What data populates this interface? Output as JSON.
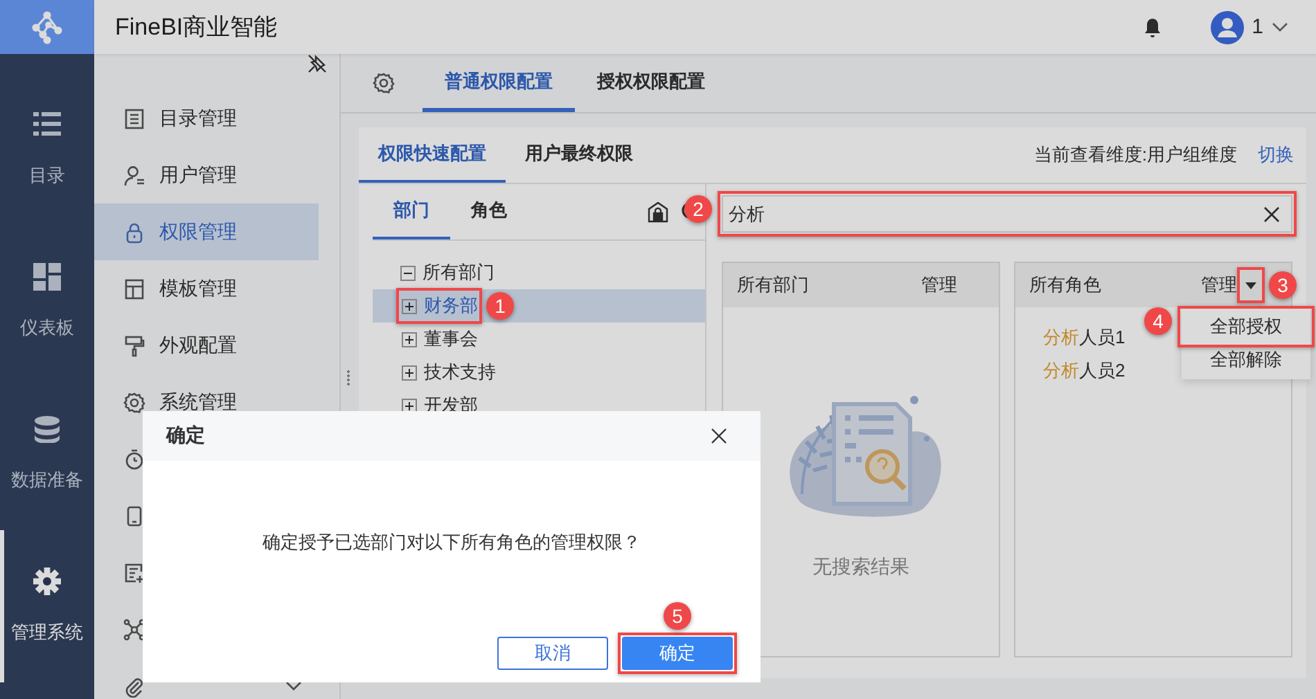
{
  "app": {
    "title": "FineBI商业智能"
  },
  "user": {
    "name": "1"
  },
  "rail": [
    {
      "label": "目录",
      "selected": false
    },
    {
      "label": "仪表板",
      "selected": false
    },
    {
      "label": "数据准备",
      "selected": false
    },
    {
      "label": "管理系统",
      "selected": true
    }
  ],
  "nav": [
    {
      "label": "目录管理",
      "selected": false
    },
    {
      "label": "用户管理",
      "selected": false
    },
    {
      "label": "权限管理",
      "selected": true
    },
    {
      "label": "模板管理",
      "selected": false
    },
    {
      "label": "外观配置",
      "selected": false
    },
    {
      "label": "系统管理",
      "selected": false
    },
    {
      "selected": false
    },
    {
      "selected": false
    },
    {
      "selected": false
    },
    {
      "selected": false
    },
    {
      "selected": false,
      "expandable": true
    }
  ],
  "tabs": [
    {
      "label": "普通权限配置",
      "selected": true
    },
    {
      "label": "授权权限配置",
      "selected": false
    }
  ],
  "subtabs": [
    {
      "label": "权限快速配置",
      "selected": true
    },
    {
      "label": "用户最终权限",
      "selected": false
    }
  ],
  "dimension": {
    "text": "当前查看维度:用户组维度",
    "link": "切换"
  },
  "entity_tabs": [
    {
      "label": "部门",
      "selected": true
    },
    {
      "label": "角色",
      "selected": false
    }
  ],
  "tree": [
    {
      "label": "所有部门",
      "expanded": true,
      "selected": false,
      "children": [
        {
          "label": "财务部",
          "expanded": false,
          "selected": true,
          "annotation": "1"
        },
        {
          "label": "董事会",
          "expanded": false,
          "selected": false
        },
        {
          "label": "技术支持",
          "expanded": false,
          "selected": false
        },
        {
          "label": "开发部",
          "expanded": false,
          "selected": false
        }
      ]
    }
  ],
  "search": {
    "value": "分析",
    "annotation": "2"
  },
  "department_table": {
    "columns": [
      "所有部门",
      "管理"
    ],
    "empty_text": "无搜索结果"
  },
  "role_table": {
    "columns": [
      "所有角色",
      "管理"
    ],
    "caret_annotation": "3",
    "menu_open": true,
    "rows": [
      {
        "match": "分析",
        "rest": "人员1"
      },
      {
        "match": "分析",
        "rest": "人员2"
      }
    ],
    "menu": [
      {
        "label": "全部授权",
        "annotation": "4"
      },
      {
        "label": "全部解除"
      }
    ]
  },
  "dialog": {
    "title": "确定",
    "message": "确定授予已选部门对以下所有角色的管理权限？",
    "buttons": [
      {
        "label": "取消",
        "kind": "secondary"
      },
      {
        "label": "确定",
        "kind": "primary",
        "annotation": "5"
      }
    ]
  }
}
